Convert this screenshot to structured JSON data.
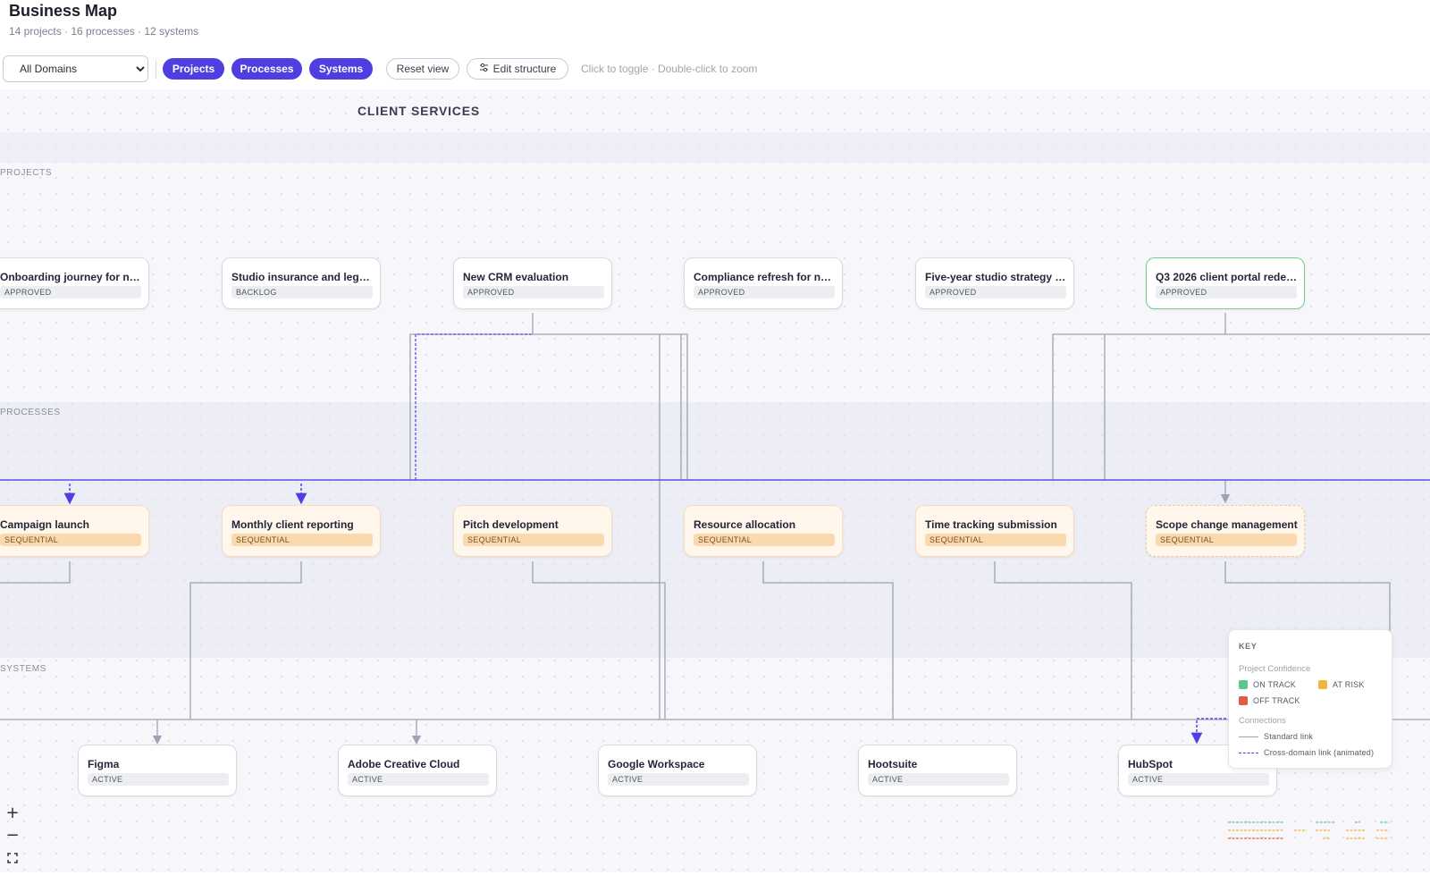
{
  "header": {
    "title": "Business Map",
    "subtitle": "14 projects · 16 processes · 12 systems"
  },
  "toolbar": {
    "domain_select": {
      "value": "All Domains",
      "options": [
        "All Domains"
      ]
    },
    "toggles": [
      "Projects",
      "Processes",
      "Systems"
    ],
    "reset_label": "Reset view",
    "edit_label": "Edit structure",
    "hint": "Click to toggle · Double-click to zoom"
  },
  "canvas": {
    "domain_title": "CLIENT SERVICES",
    "bands": {
      "projects": "PROJECTS",
      "processes": "PROCESSES",
      "systems": "SYSTEMS"
    },
    "projects": [
      {
        "title": "Onboarding journey for new ...",
        "status": "APPROVED"
      },
      {
        "title": "Studio insurance and legal r...",
        "status": "BACKLOG"
      },
      {
        "title": "New CRM evaluation",
        "status": "APPROVED"
      },
      {
        "title": "Compliance refresh for new ...",
        "status": "APPROVED"
      },
      {
        "title": "Five-year studio strategy re...",
        "status": "APPROVED"
      },
      {
        "title": "Q3 2026 client portal redesi...",
        "status": "APPROVED"
      }
    ],
    "processes": [
      {
        "title": "Campaign launch",
        "type": "SEQUENTIAL"
      },
      {
        "title": "Monthly client reporting",
        "type": "SEQUENTIAL"
      },
      {
        "title": "Pitch development",
        "type": "SEQUENTIAL"
      },
      {
        "title": "Resource allocation",
        "type": "SEQUENTIAL"
      },
      {
        "title": "Time tracking submission",
        "type": "SEQUENTIAL"
      },
      {
        "title": "Scope change management",
        "type": "SEQUENTIAL"
      }
    ],
    "systems": [
      {
        "title": "Figma",
        "status": "ACTIVE"
      },
      {
        "title": "Adobe Creative Cloud",
        "status": "ACTIVE"
      },
      {
        "title": "Google Workspace",
        "status": "ACTIVE"
      },
      {
        "title": "Hootsuite",
        "status": "ACTIVE"
      },
      {
        "title": "HubSpot",
        "status": "ACTIVE"
      }
    ]
  },
  "key": {
    "title": "KEY",
    "confidence_title": "Project Confidence",
    "on_track": "ON TRACK",
    "at_risk": "AT RISK",
    "off_track": "OFF TRACK",
    "connections_title": "Connections",
    "standard_link": "Standard link",
    "cross_domain_link": "Cross-domain link (animated)"
  },
  "zoom": {
    "in": "+",
    "out": "−",
    "fit": "⛶"
  },
  "colors": {
    "accent": "#4f3fe0",
    "on_track": "#5cc98a",
    "at_risk": "#f2b43c",
    "off_track": "#e25c45",
    "process_fill": "#fff6ec",
    "process_badge": "#fbd9ae",
    "link": "#9da3b4"
  }
}
